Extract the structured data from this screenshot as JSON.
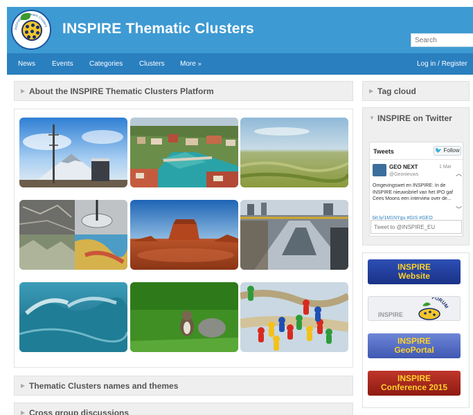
{
  "header": {
    "site_title": "INSPIRE Thematic Clusters",
    "logo_ring_text": "INSPIRE · Thematic Clusters",
    "search_placeholder": "Search"
  },
  "nav": {
    "items": [
      {
        "label": "News"
      },
      {
        "label": "Events"
      },
      {
        "label": "Categories"
      },
      {
        "label": "Clusters"
      },
      {
        "label": "More"
      }
    ],
    "more_arrow": "»",
    "login_label": "Log in / Register"
  },
  "main": {
    "about_title": "About the INSPIRE Thematic Clusters Platform",
    "themes_title": "Thematic Clusters names and themes",
    "discussions_title": "Cross group discussions",
    "gallery": [
      {
        "name": "antenna-mountain-photo",
        "icon": "antenna"
      },
      {
        "name": "town-river-aerial-photo",
        "icon": "town"
      },
      {
        "name": "wetland-landscape-photo",
        "icon": "landscape"
      },
      {
        "name": "maps-collage-photo",
        "icon": "maps"
      },
      {
        "name": "desert-butte-photo",
        "icon": "desert"
      },
      {
        "name": "water-infrastructure-photo",
        "icon": "infrastructure"
      },
      {
        "name": "ocean-wave-photo",
        "icon": "wave"
      },
      {
        "name": "squirrel-grass-photo",
        "icon": "squirrel"
      },
      {
        "name": "game-pieces-map-photo",
        "icon": "pawns"
      }
    ]
  },
  "sidebar": {
    "tag_cloud_title": "Tag cloud",
    "twitter_title": "INSPIRE on Twitter",
    "tweets": {
      "title": "Tweets",
      "follow_label": "Follow",
      "name": "GEO NEXT",
      "handle": "@Geonieuws",
      "date": "1 Mar",
      "text": "Omgevingswet en INSPIRE: In de INSPIRE nieuwsbrief van het IPO gaf Cees Moons een interview over de...",
      "link": "bit.ly/1M1NYgu #GIS #GEO",
      "tweet_to_placeholder": "Tweet to @INSPIRE_EU"
    },
    "banners": [
      {
        "line1": "INSPIRE",
        "line2": "Website"
      },
      {
        "line1": "INSPIRE",
        "line2": "FORUM"
      },
      {
        "line1": "INSPIRE",
        "line2": "GeoPortal"
      },
      {
        "line1": "INSPIRE",
        "line2": "Conference 2015"
      }
    ]
  },
  "colors": {
    "header_bg": "#3e9ad3",
    "nav_bg": "#2a7fbf",
    "banner_blue": "#1f3e9a",
    "banner_red": "#a4201a",
    "banner_text": "#ffd22a"
  }
}
